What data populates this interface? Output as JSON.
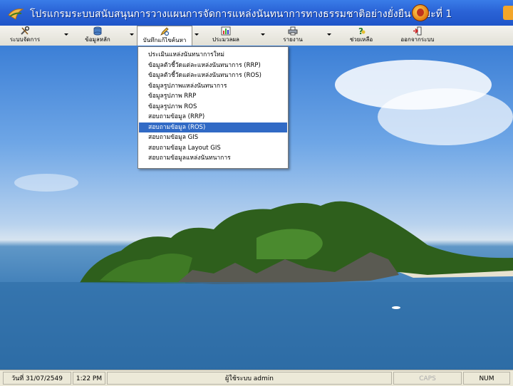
{
  "window": {
    "title": "โปรแกรมระบบสนับสนุนการวางแผนการจัดการแหล่งนันทนาการทางธรรมชาติอย่างยั่งยืน ระยะที่ 1"
  },
  "toolbar": {
    "items": [
      {
        "label": "ระบบจัดการ",
        "icon": "tools-icon"
      },
      {
        "label": "ข้อมูลหลัก",
        "icon": "database-icon"
      },
      {
        "label": "บันทึกแก้ไขค้นหา",
        "icon": "edit-search-icon"
      },
      {
        "label": "ประมวลผล",
        "icon": "chart-icon"
      },
      {
        "label": "รายงาน",
        "icon": "printer-icon"
      },
      {
        "label": "ช่วยเหลือ",
        "icon": "help-icon"
      },
      {
        "label": "ออกจากระบบ",
        "icon": "exit-icon"
      }
    ]
  },
  "menu": {
    "items": [
      "ประเมินแหล่งนันทนาการใหม่",
      "ข้อมูลตัวชี้วัดแต่ละแหล่งนันทนาการ (RRP)",
      "ข้อมูลตัวชี้วัดแต่ละแหล่งนันทนาการ (ROS)",
      "ข้อมูลรูปภาพแหล่งนันทนาการ",
      "ข้อมูลรูปภาพ RRP",
      "ข้อมูลรูปภาพ ROS",
      "สอบถามข้อมูล (RRP)",
      "สอบถามข้อมูล (ROS)",
      "สอบถามข้อมูล GIS",
      "สอบถามข้อมูล Layout GIS",
      "สอบถามข้อมูลแหล่งนันทนาการ"
    ],
    "selected_index": 7
  },
  "statusbar": {
    "date": "วันที่  31/07/2549",
    "time": "1:22 PM",
    "user": "ผู้ใช้ระบบ admin",
    "caps": "CAPS",
    "num": "NUM"
  },
  "colors": {
    "title_bar": "#2a63d6",
    "menu_highlight": "#316ac5",
    "toolbar_bg": "#ece9d8"
  }
}
